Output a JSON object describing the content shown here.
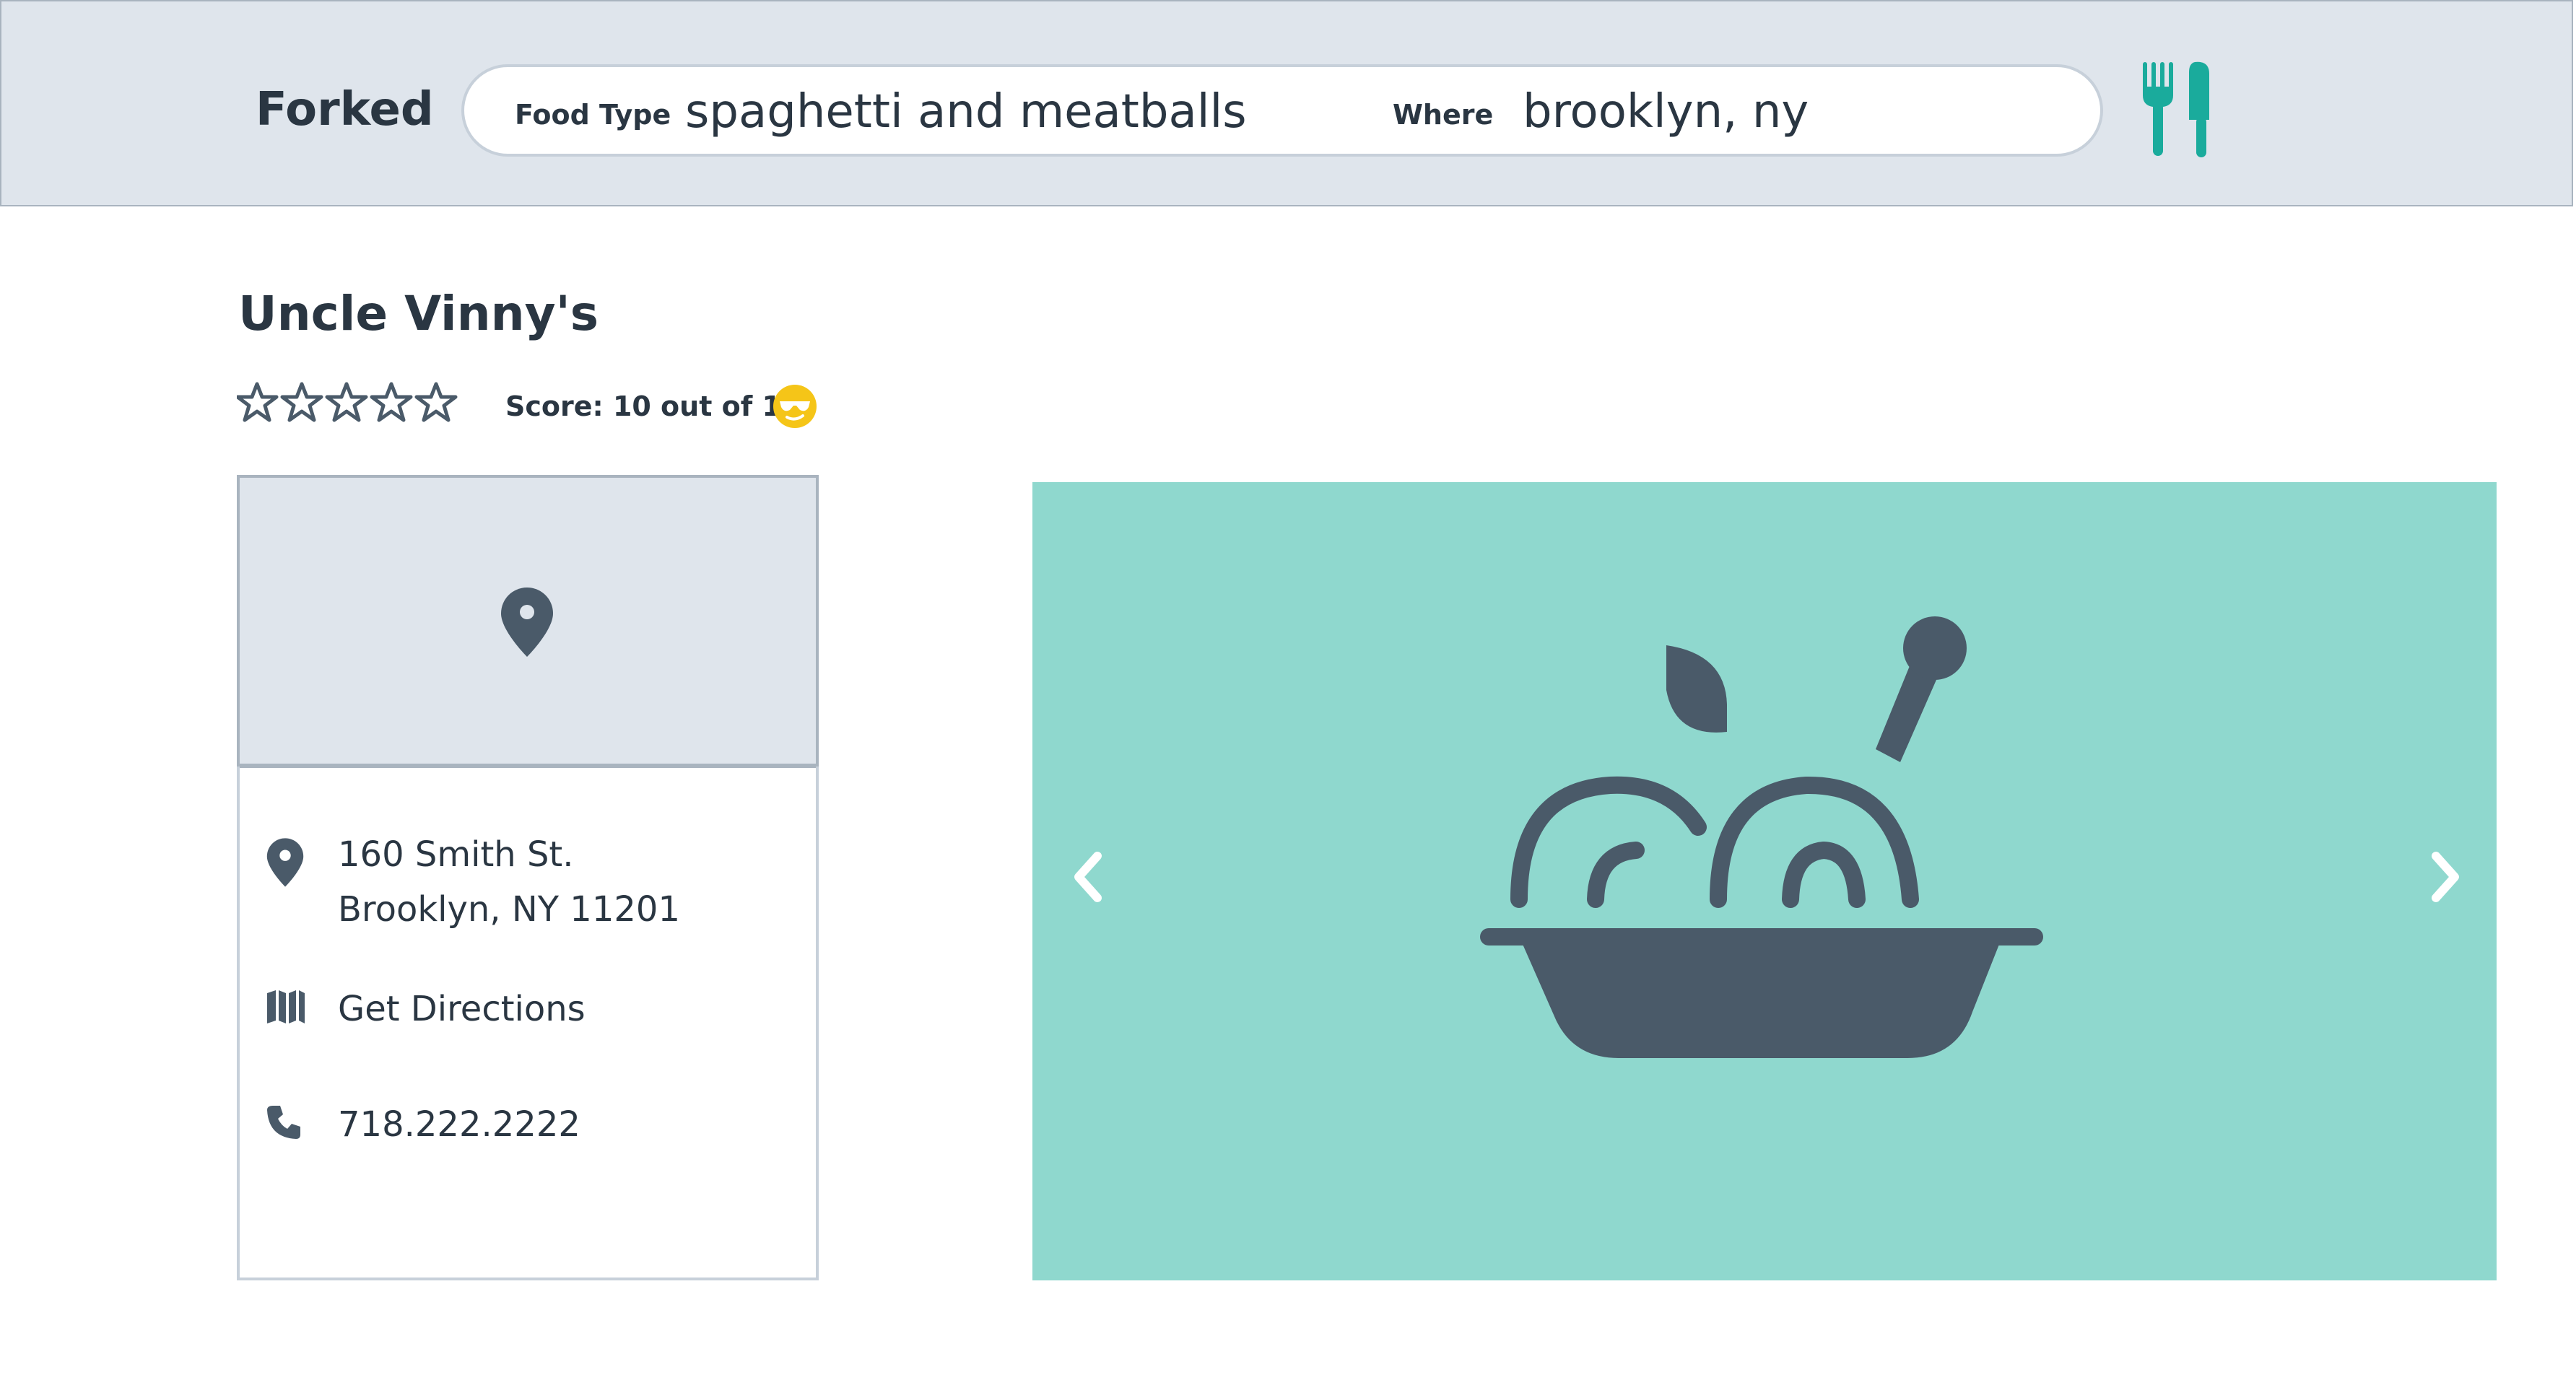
{
  "app": {
    "name": "Forked"
  },
  "search": {
    "food_type_label": "Food Type",
    "food_type_value": "spaghetti and meatballs",
    "where_label": "Where",
    "where_value": "brooklyn, ny"
  },
  "restaurant": {
    "name": "Uncle Vinny's",
    "stars_outlined": 5,
    "score_text": "Score: 10 out of 10",
    "address_line1": "160 Smith St.",
    "address_line2": "Brooklyn, NY 11201",
    "directions_label": "Get Directions",
    "phone": "718.222.2222"
  },
  "icons": {
    "logo_mark": "fork-and-knife-icon",
    "rating": "star-outline-icon",
    "score_emoji": "cool-sunglasses-emoji-icon",
    "map": "map-pin-icon",
    "address": "map-pin-icon",
    "directions": "map-folded-icon",
    "phone": "phone-icon",
    "carousel_prev": "chevron-left-icon",
    "carousel_next": "chevron-right-icon",
    "photo_placeholder": "bowl-of-meatballs-icon"
  },
  "colors": {
    "header_bg": "#dfe5ec",
    "accent_teal": "#1aab9c",
    "carousel_bg": "#8fd8ce",
    "icon_slate": "#4a5a69",
    "text_dark": "#2a3642",
    "emoji_yellow": "#f5c518"
  }
}
